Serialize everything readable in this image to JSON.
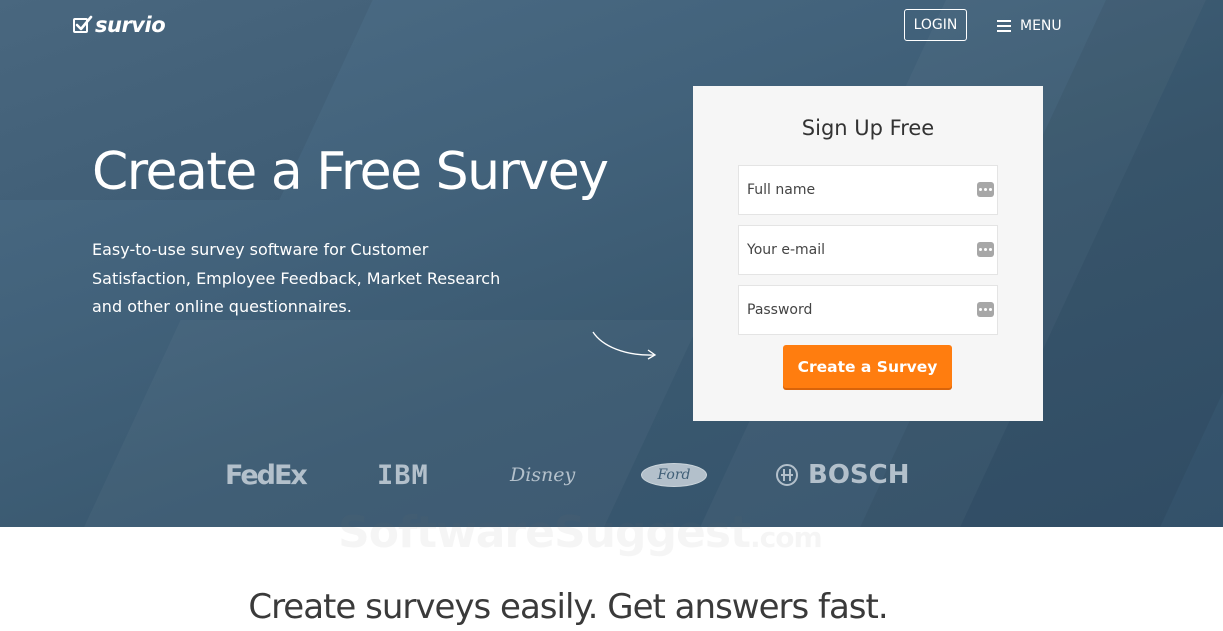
{
  "header": {
    "logo_text": "survio",
    "login_label": "LOGIN",
    "menu_label": "MENU"
  },
  "hero": {
    "title": "Create a Free Survey",
    "subtitle": "Easy-to-use survey software for Customer Satisfaction, Employee Feedback, Market Research and other online questionnaires."
  },
  "signup": {
    "title": "Sign Up Free",
    "fields": [
      {
        "placeholder": "Full name",
        "value": ""
      },
      {
        "placeholder": "Your e-mail",
        "value": ""
      },
      {
        "placeholder": "Password",
        "value": ""
      }
    ],
    "submit_label": "Create a Survey"
  },
  "brands": [
    "FedEx",
    "IBM",
    "Disney",
    "Ford",
    "BOSCH"
  ],
  "watermark": {
    "main": "SoftwareSuggest",
    "suffix": ".com"
  },
  "tagline": "Create surveys easily. Get answers fast.",
  "colors": {
    "hero_bg": "#42627b",
    "accent": "#ff7d0f",
    "card_bg": "#f6f6f6",
    "brand_logo": "#b3c0cb"
  },
  "icons": {
    "logo": "check-box-icon",
    "menu": "hamburger-icon",
    "field": "password-manager-icon",
    "arrow": "curved-arrow-icon"
  }
}
